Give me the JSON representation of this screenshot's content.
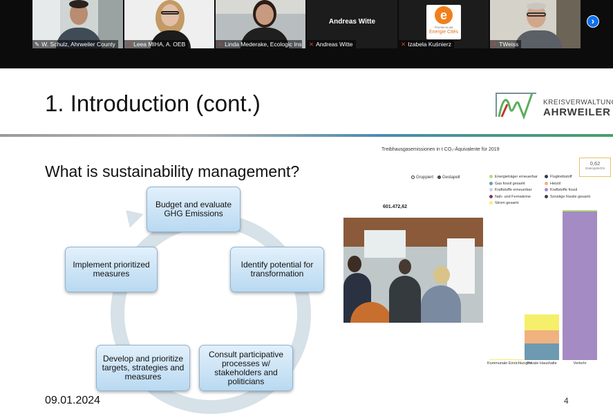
{
  "meeting": {
    "participants": [
      {
        "name": "W. Schulz, Ahrweiler County",
        "muted": false,
        "pinned": true
      },
      {
        "name": "Leea MIHA, A. OEB",
        "muted": true
      },
      {
        "name": "Linda Mederake, Ecologic Inst...",
        "muted": true
      },
      {
        "name": "Andreas Witte",
        "muted": true,
        "display_name": "Andreas Witte"
      },
      {
        "name": "Izabela Kuśnierz",
        "muted": true,
        "logo_text_top": "POLSKI KLUB",
        "logo_text": "Energie Cités"
      },
      {
        "name": "TWeiss",
        "muted": true
      }
    ],
    "next_label": "›"
  },
  "slide": {
    "title": "1. Introduction (cont.)",
    "logo_line1": "KREISVERWALTUNG",
    "logo_line2": "AHRWEILER",
    "subtitle": "What is sustainability management?",
    "cycle": [
      "Budget and evaluate GHG Emissions",
      "Identify potential for transformation",
      "Consult participative processes w/ stakeholders and politicians",
      "Develop and prioritize targets, strategies and measures",
      "Implement prioritized measures"
    ],
    "date": "09.01.2024",
    "page": "4"
  },
  "chart_data": {
    "type": "bar",
    "title": "Treibhausgasemissionen in t CO₂-Äquivalente für 2019",
    "kpi": {
      "value": "0,62",
      "label": "Datengüte/ΣN"
    },
    "toggle": {
      "option_a": "Gruppiert",
      "option_b": "Gestapelt",
      "selected": "Gestapelt"
    },
    "total_label": "601.472,62",
    "categories": [
      "Kommunale Einrichtungen",
      "Private Haushalte",
      "Verkehr"
    ],
    "legend": [
      {
        "name": "Energieträger erneuerbar",
        "color": "#b6dc77"
      },
      {
        "name": "Flugtreibstoff",
        "color": "#2f3a55"
      },
      {
        "name": "Gas fossil gesamt",
        "color": "#6d9ab0"
      },
      {
        "name": "Heizöl",
        "color": "#f0b27f"
      },
      {
        "name": "Kraftstoffe erneuerbar",
        "color": "#cfcfdd"
      },
      {
        "name": "Kraftstoffe fossil",
        "color": "#a48bc4"
      },
      {
        "name": "Nah- und Fernwärme",
        "color": "#7e3a55"
      },
      {
        "name": "Sonstige fossile gesamt",
        "color": "#444444"
      },
      {
        "name": "Strom gesamt",
        "color": "#f6ef6b"
      }
    ],
    "series": [
      {
        "name": "Gas fossil gesamt",
        "color": "#6d9ab0",
        "values": [
          0,
          66000,
          0
        ]
      },
      {
        "name": "Heizöl",
        "color": "#f0b27f",
        "values": [
          0,
          55000,
          0
        ]
      },
      {
        "name": "Strom gesamt",
        "color": "#f6ef6b",
        "values": [
          4000,
          63000,
          0
        ]
      },
      {
        "name": "Kraftstoffe fossil",
        "color": "#a48bc4",
        "values": [
          0,
          0,
          601000
        ]
      },
      {
        "name": "Energieträger erneuerbar",
        "color": "#b6dc77",
        "values": [
          0,
          0,
          7000
        ]
      }
    ],
    "ylim": [
      0,
      615000
    ],
    "grid": false
  }
}
